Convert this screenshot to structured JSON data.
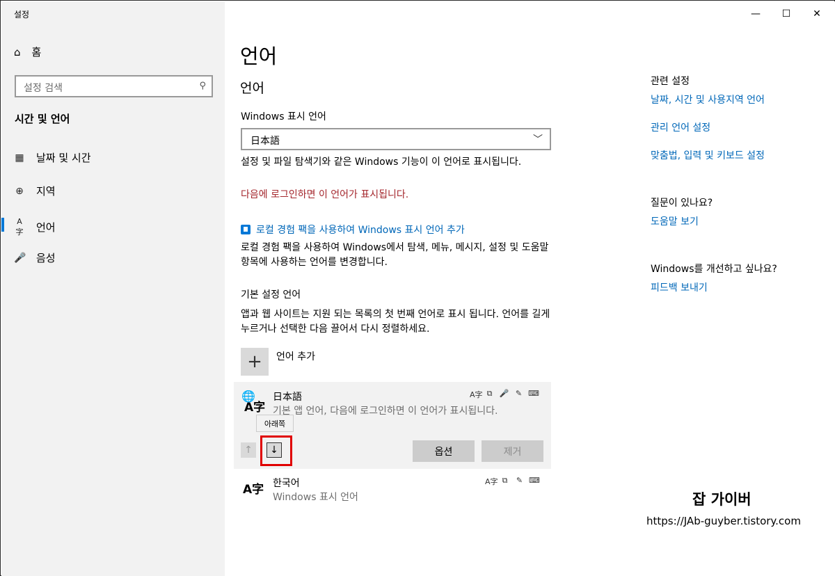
{
  "window": {
    "title": "설정",
    "controls": {
      "minimize": "—",
      "maximize": "☐",
      "close": "✕"
    }
  },
  "sidebar": {
    "home_label": "홈",
    "search_placeholder": "설정 검색",
    "section_title": "시간 및 언어",
    "items": [
      {
        "label": "날짜 및 시간",
        "icon": "calendar-clock-icon"
      },
      {
        "label": "지역",
        "icon": "globe-icon"
      },
      {
        "label": "언어",
        "icon": "language-icon",
        "selected": true
      },
      {
        "label": "음성",
        "icon": "microphone-icon"
      }
    ]
  },
  "main": {
    "page_title": "언어",
    "section_title": "언어",
    "display_language_label": "Windows 표시 언어",
    "display_language_value": "日本語",
    "display_language_desc": "설정 및 파일 탐색기와 같은 Windows 기능이 이 언어로 표시됩니다.",
    "signin_notice": "다음에 로그인하면 이 언어가 표시됩니다.",
    "local_pack_link": "로컬 경험 팩을 사용하여 Windows 표시 언어 추가",
    "local_pack_desc": "로컬 경험 팩을 사용하여 Windows에서 탐색, 메뉴, 메시지, 설정 및 도움말 항목에 사용하는 언어를 변경합니다.",
    "preferred_title": "기본 설정 언어",
    "preferred_desc": "앱과 웹 사이트는 지원 되는 목록의 첫 번째 언어로 표시 됩니다. 언어를 길게 누르거나 선택한 다음 끌어서 다시 정렬하세요.",
    "add_language_label": "언어 추가",
    "languages": [
      {
        "name": "日本語",
        "subtitle": "기본 앱 언어, 다음에 로그인하면 이 언어가 표시됩니다.",
        "glyph_top": "🌐",
        "glyph": "A字",
        "features": [
          "A字",
          "⧉",
          "🎤",
          "✎",
          "⌨"
        ],
        "tooltip": "아래쪽",
        "options_label": "옵션",
        "remove_label": "제거",
        "up_arrow": "↑",
        "down_arrow": "↓"
      },
      {
        "name": "한국어",
        "subtitle": "Windows 표시 언어",
        "glyph": "A字",
        "features": [
          "A字",
          "⧉",
          "✎",
          "⌨"
        ]
      }
    ]
  },
  "related": {
    "title": "관련 설정",
    "links": [
      "날짜, 시간 및 사용지역 언어",
      "관리 언어 설정",
      "맞춤법, 입력 및 키보드 설정"
    ],
    "help_title": "질문이 있나요?",
    "help_link": "도움말 보기",
    "improve_title": "Windows를 개선하고 싶나요?",
    "feedback_link": "피드백 보내기"
  },
  "watermark": {
    "title": "잡 가이버",
    "url": "https://JAb-guyber.tistory.com"
  }
}
